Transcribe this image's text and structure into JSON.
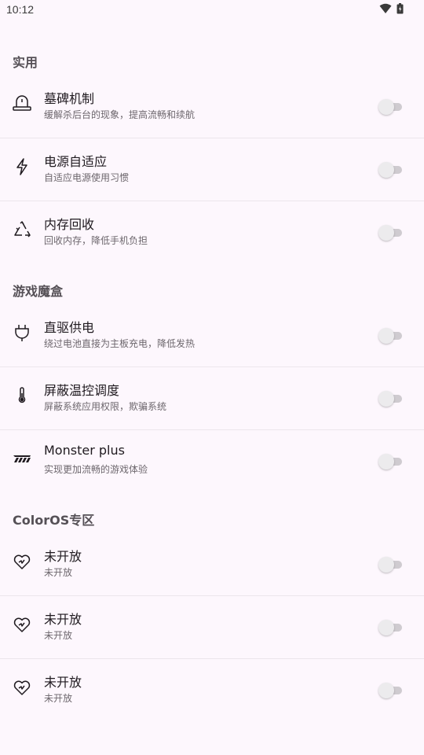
{
  "status_bar": {
    "time": "10:12"
  },
  "sections": [
    {
      "title": "实用",
      "items": [
        {
          "icon": "tombstone-icon",
          "title": "墓碑机制",
          "subtitle": "缓解杀后台的现象，提高流畅和续航",
          "enabled": false
        },
        {
          "icon": "lightning-icon",
          "title": "电源自适应",
          "subtitle": "自适应电源使用习惯",
          "enabled": false
        },
        {
          "icon": "recycle-icon",
          "title": "内存回收",
          "subtitle": "回收内存，降低手机负担",
          "enabled": false
        }
      ]
    },
    {
      "title": "游戏魔盒",
      "items": [
        {
          "icon": "plug-icon",
          "title": "直驱供电",
          "subtitle": "绕过电池直接为主板充电，降低发热",
          "enabled": false
        },
        {
          "icon": "thermometer-icon",
          "title": "屏蔽温控调度",
          "subtitle": "屏蔽系统应用权限，欺骗系统",
          "enabled": false
        },
        {
          "icon": "monster-logo-icon",
          "title": "Monster plus",
          "subtitle": "实现更加流畅的游戏体验",
          "enabled": false
        }
      ]
    },
    {
      "title": "ColorOS专区",
      "items": [
        {
          "icon": "heart-pulse-icon",
          "title": "未开放",
          "subtitle": "未开放",
          "enabled": false
        },
        {
          "icon": "heart-pulse-icon",
          "title": "未开放",
          "subtitle": "未开放",
          "enabled": false
        },
        {
          "icon": "heart-pulse-icon",
          "title": "未开放",
          "subtitle": "未开放",
          "enabled": false
        }
      ]
    }
  ]
}
